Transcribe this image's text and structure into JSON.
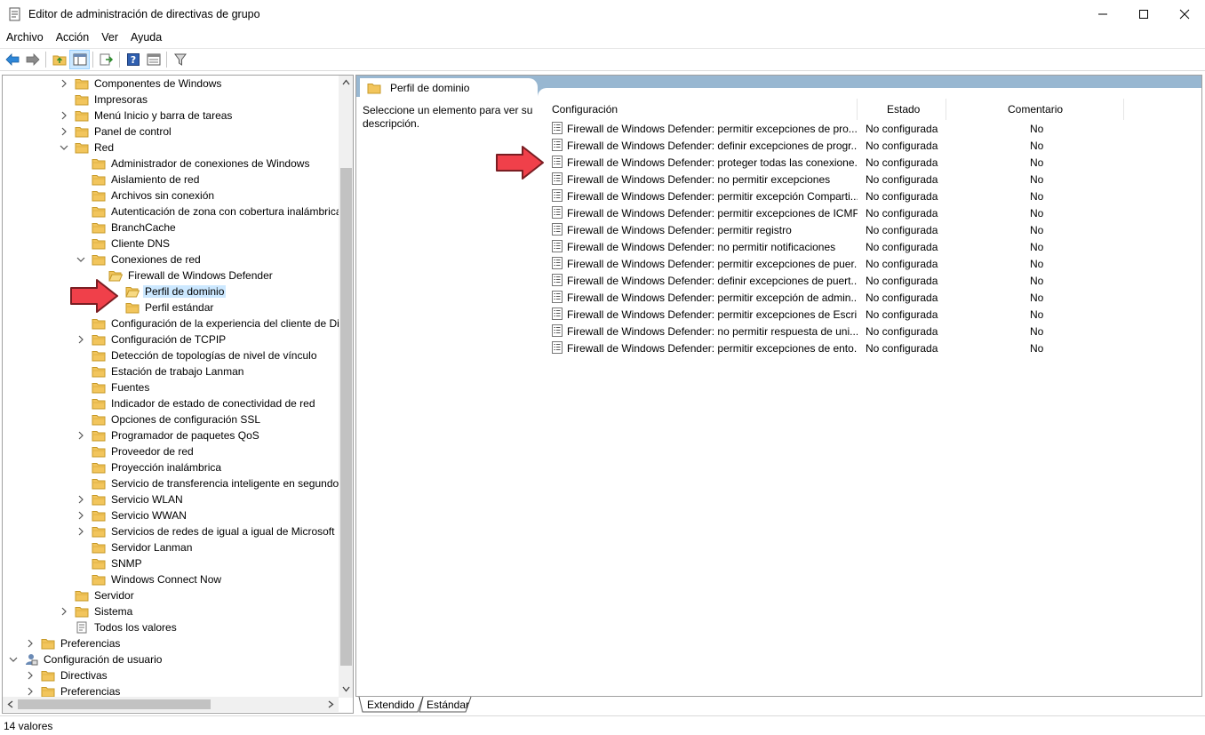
{
  "window": {
    "title": "Editor de administración de directivas de grupo"
  },
  "menu": [
    "Archivo",
    "Acción",
    "Ver",
    "Ayuda"
  ],
  "colors": {
    "selection": "#cce8ff",
    "header_band": "#98b7d1",
    "arrow": "#f0404a",
    "folder": "#f2c55c"
  },
  "tree": [
    {
      "label": "Componentes de Windows",
      "icon": "folder-icon",
      "expander": "collapsed"
    },
    {
      "label": "Impresoras",
      "icon": "folder-icon",
      "expander": "none"
    },
    {
      "label": "Menú Inicio y barra de tareas",
      "icon": "folder-icon",
      "expander": "collapsed"
    },
    {
      "label": "Panel de control",
      "icon": "folder-icon",
      "expander": "collapsed"
    },
    {
      "label": "Red",
      "icon": "folder-icon",
      "expander": "expanded"
    },
    {
      "label": "Administrador de conexiones de Windows",
      "icon": "folder-icon",
      "expander": "none"
    },
    {
      "label": "Aislamiento de red",
      "icon": "folder-icon",
      "expander": "none"
    },
    {
      "label": "Archivos sin conexión",
      "icon": "folder-icon",
      "expander": "none"
    },
    {
      "label": "Autenticación de zona con cobertura inalámbrica",
      "icon": "folder-icon",
      "expander": "none"
    },
    {
      "label": "BranchCache",
      "icon": "folder-icon",
      "expander": "none"
    },
    {
      "label": "Cliente DNS",
      "icon": "folder-icon",
      "expander": "none"
    },
    {
      "label": "Conexiones de red",
      "icon": "folder-icon",
      "expander": "expanded"
    },
    {
      "label": "Firewall de Windows Defender",
      "icon": "folder-open-icon",
      "expander": "none"
    },
    {
      "label": "Perfil de dominio",
      "icon": "folder-open-icon",
      "expander": "none",
      "selected": true
    },
    {
      "label": "Perfil estándar",
      "icon": "folder-icon",
      "expander": "none"
    },
    {
      "label": "Configuración de la experiencia del cliente de Dir",
      "icon": "folder-icon",
      "expander": "none"
    },
    {
      "label": "Configuración de TCPIP",
      "icon": "folder-icon",
      "expander": "collapsed"
    },
    {
      "label": "Detección de topologías de nivel de vínculo",
      "icon": "folder-icon",
      "expander": "none"
    },
    {
      "label": "Estación de trabajo Lanman",
      "icon": "folder-icon",
      "expander": "none"
    },
    {
      "label": "Fuentes",
      "icon": "folder-icon",
      "expander": "none"
    },
    {
      "label": "Indicador de estado de conectividad de red",
      "icon": "folder-icon",
      "expander": "none"
    },
    {
      "label": "Opciones de configuración SSL",
      "icon": "folder-icon",
      "expander": "none"
    },
    {
      "label": "Programador de paquetes QoS",
      "icon": "folder-icon",
      "expander": "collapsed"
    },
    {
      "label": "Proveedor de red",
      "icon": "folder-icon",
      "expander": "none"
    },
    {
      "label": "Proyección inalámbrica",
      "icon": "folder-icon",
      "expander": "none"
    },
    {
      "label": "Servicio de transferencia inteligente en segundo p",
      "icon": "folder-icon",
      "expander": "none"
    },
    {
      "label": "Servicio WLAN",
      "icon": "folder-icon",
      "expander": "collapsed"
    },
    {
      "label": "Servicio WWAN",
      "icon": "folder-icon",
      "expander": "collapsed"
    },
    {
      "label": "Servicios de redes de igual a igual de Microsoft",
      "icon": "folder-icon",
      "expander": "collapsed"
    },
    {
      "label": "Servidor Lanman",
      "icon": "folder-icon",
      "expander": "none"
    },
    {
      "label": "SNMP",
      "icon": "folder-icon",
      "expander": "none"
    },
    {
      "label": "Windows Connect Now",
      "icon": "folder-icon",
      "expander": "none"
    },
    {
      "label": "Servidor",
      "icon": "folder-icon",
      "expander": "none"
    },
    {
      "label": "Sistema",
      "icon": "folder-icon",
      "expander": "collapsed"
    },
    {
      "label": "Todos los valores",
      "icon": "all-settings-icon",
      "expander": "none"
    },
    {
      "label": "Preferencias",
      "icon": "folder-icon",
      "expander": "collapsed"
    },
    {
      "label": "Configuración de usuario",
      "icon": "user-config-icon",
      "expander": "expanded"
    },
    {
      "label": "Directivas",
      "icon": "folder-icon",
      "expander": "collapsed"
    },
    {
      "label": "Preferencias",
      "icon": "folder-icon",
      "expander": "collapsed"
    }
  ],
  "right": {
    "header_title": "Perfil de dominio",
    "description": "Seleccione un elemento para ver su descripción.",
    "columns": [
      "Configuración",
      "Estado",
      "Comentario"
    ],
    "rows": [
      [
        "Firewall de Windows Defender: permitir excepciones de pro...",
        "No configurada",
        "No"
      ],
      [
        "Firewall de Windows Defender: definir excepciones de progr...",
        "No configurada",
        "No"
      ],
      [
        "Firewall de Windows Defender: proteger todas las conexione...",
        "No configurada",
        "No"
      ],
      [
        "Firewall de Windows Defender: no permitir excepciones",
        "No configurada",
        "No"
      ],
      [
        "Firewall de Windows Defender: permitir excepción Comparti...",
        "No configurada",
        "No"
      ],
      [
        "Firewall de Windows Defender: permitir excepciones de ICMP",
        "No configurada",
        "No"
      ],
      [
        "Firewall de Windows Defender: permitir registro",
        "No configurada",
        "No"
      ],
      [
        "Firewall de Windows Defender: no permitir notificaciones",
        "No configurada",
        "No"
      ],
      [
        "Firewall de Windows Defender: permitir excepciones de puer...",
        "No configurada",
        "No"
      ],
      [
        "Firewall de Windows Defender: definir excepciones de puert...",
        "No configurada",
        "No"
      ],
      [
        "Firewall de Windows Defender: permitir excepción de admin...",
        "No configurada",
        "No"
      ],
      [
        "Firewall de Windows Defender: permitir excepciones de Escri...",
        "No configurada",
        "No"
      ],
      [
        "Firewall de Windows Defender: no permitir respuesta de uni...",
        "No configurada",
        "No"
      ],
      [
        "Firewall de Windows Defender: permitir excepciones de ento...",
        "No configurada",
        "No"
      ]
    ]
  },
  "bottom_tabs": [
    "Extendido",
    "Estándar"
  ],
  "status": "14 valores"
}
